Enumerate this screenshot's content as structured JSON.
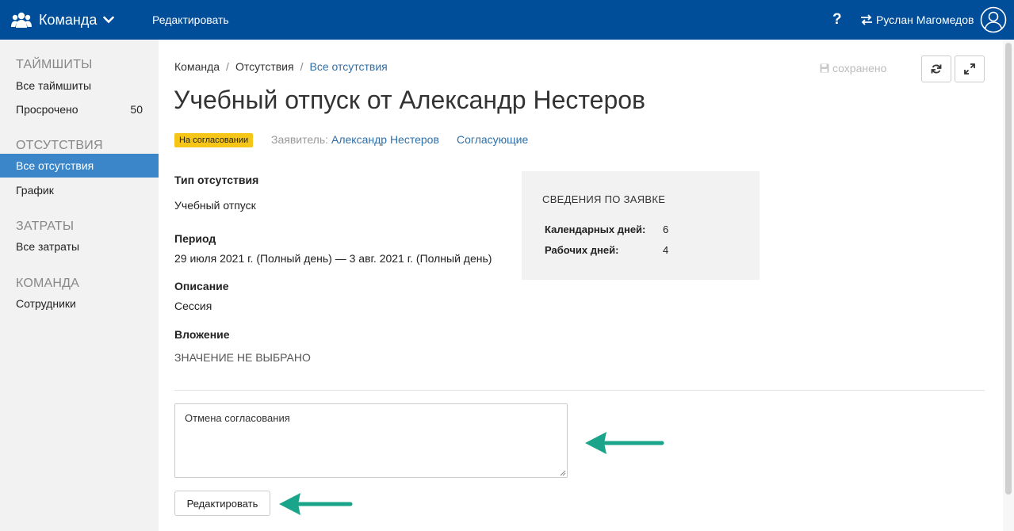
{
  "topbar": {
    "brand": "Команда",
    "edit_link": "Редактировать",
    "help": "?",
    "user_name": "Руслан Магомедов"
  },
  "sidebar": {
    "groups": [
      {
        "title": "ТАЙМШИТЫ",
        "items": [
          {
            "label": "Все таймшиты"
          },
          {
            "label": "Просрочено",
            "count": "50"
          }
        ]
      },
      {
        "title": "ОТСУТСТВИЯ",
        "items": [
          {
            "label": "Все отсутствия",
            "active": true
          },
          {
            "label": "График"
          }
        ]
      },
      {
        "title": "ЗАТРАТЫ",
        "items": [
          {
            "label": "Все затраты"
          }
        ]
      },
      {
        "title": "КОМАНДА",
        "items": [
          {
            "label": "Сотрудники"
          }
        ]
      }
    ]
  },
  "breadcrumb": [
    "Команда",
    "Отсутствия",
    "Все отсутствия"
  ],
  "saved_status": "сохранено",
  "page": {
    "title": "Учебный отпуск от Александр Нестеров",
    "status_badge": "На согласовании",
    "applicant_label": "Заявитель:",
    "applicant_name": "Александр Нестеров",
    "approvers_link": "Согласующие"
  },
  "fields": [
    {
      "label": "Тип отсутствия",
      "value": "Учебный отпуск"
    },
    {
      "label": "Период",
      "value": "29 июля 2021 г. (Полный день) — 3 авг. 2021 г. (Полный день)"
    },
    {
      "label": "Описание",
      "value": "Сессия"
    },
    {
      "label": "Вложение",
      "value": "ЗНАЧЕНИЕ НЕ ВЫБРАНО"
    }
  ],
  "info_panel": {
    "title": "СВЕДЕНИЯ ПО ЗАЯВКЕ",
    "rows": [
      {
        "label": "Календарных дней:",
        "value": "6"
      },
      {
        "label": "Рабочих дней:",
        "value": "4"
      }
    ]
  },
  "comment": {
    "value": "Отмена согласования"
  },
  "edit_button": "Редактировать",
  "colors": {
    "topbar": "#004d99",
    "active_item": "#3a86c8",
    "link": "#2f6fa8",
    "badge": "#f5c518",
    "annotation_arrow": "#1aa58a"
  },
  "icons": [
    "team-icon",
    "chevron-down-icon",
    "help-icon",
    "switch-user-icon",
    "avatar-icon",
    "save-disk-icon",
    "refresh-icon",
    "expand-icon",
    "arrow-annotation"
  ]
}
